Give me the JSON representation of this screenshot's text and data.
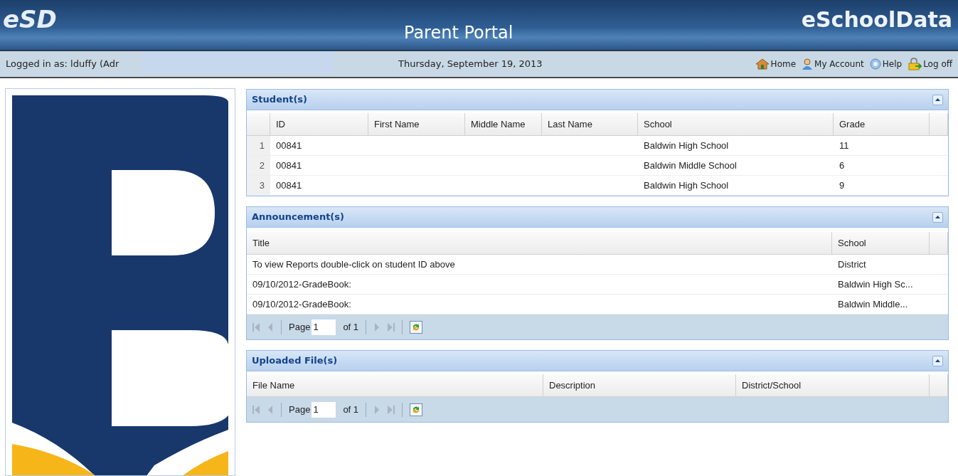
{
  "header": {
    "logo": "eSD",
    "title": "Parent Portal",
    "brand": "eSchoolData"
  },
  "info_bar": {
    "logged_in": "Logged in as: lduffy (Adr",
    "date": "Thursday, September 19, 2013",
    "links": [
      {
        "label": "Home",
        "kind": "home"
      },
      {
        "label": "My Account",
        "kind": "account"
      },
      {
        "label": "Help",
        "kind": "help"
      },
      {
        "label": "Log off",
        "kind": "logoff"
      }
    ]
  },
  "students": {
    "title": "Student(s)",
    "columns": [
      "ID",
      "First Name",
      "Middle Name",
      "Last Name",
      "School",
      "Grade"
    ],
    "rows": [
      {
        "number": "1",
        "id": "00841",
        "school": "Baldwin High School",
        "grade": "11"
      },
      {
        "number": "2",
        "id": "00841",
        "school": "Baldwin Middle School",
        "grade": "6"
      },
      {
        "number": "3",
        "id": "00841",
        "school": "Baldwin High School",
        "grade": "9"
      }
    ]
  },
  "announcements": {
    "title": "Announcement(s)",
    "columns": [
      "Title",
      "School"
    ],
    "rows": [
      {
        "title": "To view Reports double-click on student ID above",
        "school": "District"
      },
      {
        "title": "09/10/2012-GradeBook:",
        "school": "Baldwin High Sc..."
      },
      {
        "title": "09/10/2012-GradeBook:",
        "school": "Baldwin Middle..."
      }
    ],
    "pager": {
      "label": "Page",
      "value": "1",
      "of": "of 1"
    }
  },
  "uploaded_files": {
    "title": "Uploaded File(s)",
    "columns": [
      "File Name",
      "Description",
      "District/School"
    ],
    "pager": {
      "label": "Page",
      "value": "1",
      "of": "of 1"
    }
  }
}
